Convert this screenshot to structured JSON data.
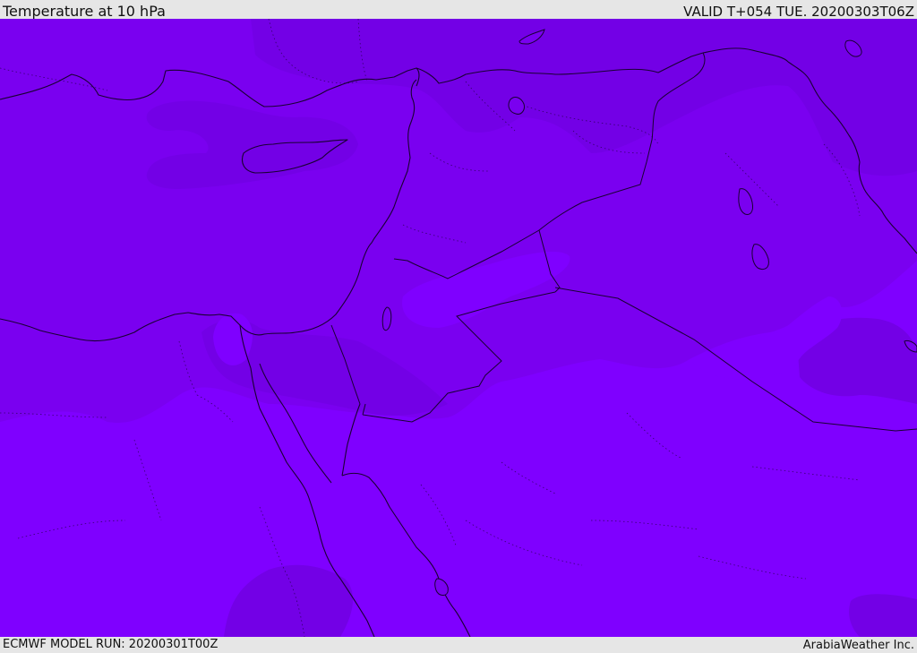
{
  "header": {
    "title": "Temperature at 10 hPa",
    "valid": "VALID T+054 TUE. 20200303T06Z"
  },
  "footer": {
    "model_run": "ECMWF MODEL RUN: 20200301T00Z",
    "credit": "ArabiaWeather Inc."
  },
  "map": {
    "colors": {
      "band_cold": "#7300e6",
      "band_mid": "#7a00f0",
      "band_warm": "#7f00ff",
      "coast": "#1a0033"
    }
  }
}
